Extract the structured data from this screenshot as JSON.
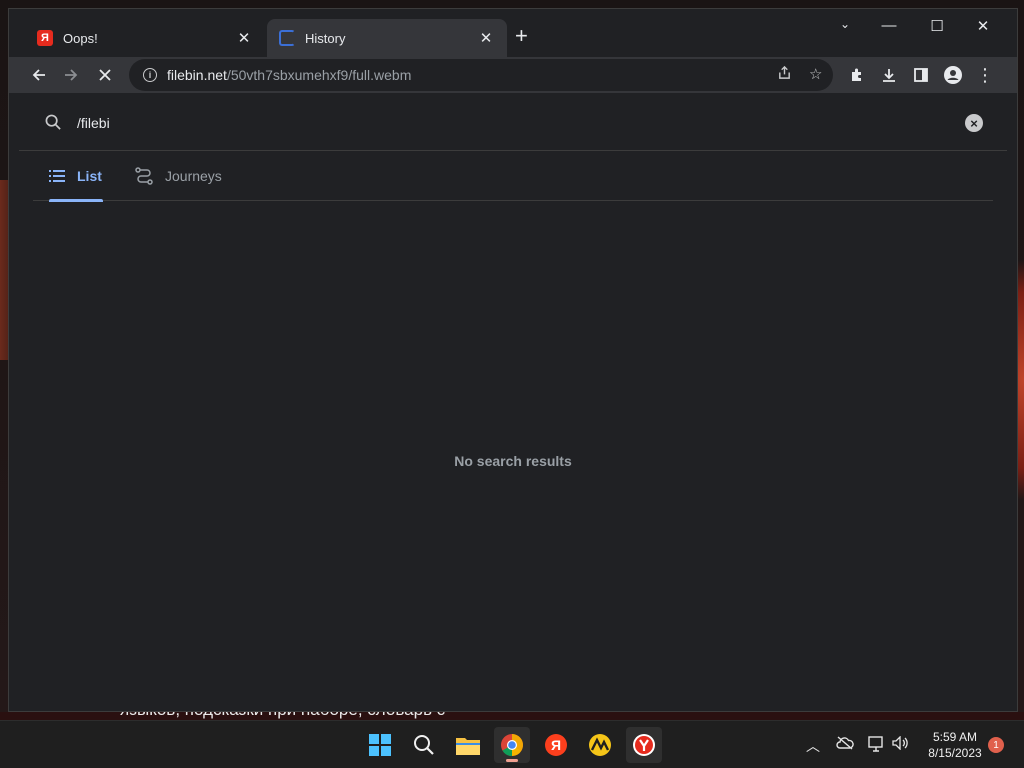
{
  "browser": {
    "tabs": [
      {
        "title": "Oops!",
        "favicon": "yandex-icon",
        "active": false
      },
      {
        "title": "History",
        "favicon": "loading-spinner-icon",
        "active": true
      }
    ],
    "url_host": "filebin.net",
    "url_path": "/50vth7sbxumehxf9/full.webm"
  },
  "history": {
    "search_value": "/filebi",
    "tabs": [
      {
        "label": "List",
        "icon": "list-icon",
        "selected": true
      },
      {
        "label": "Journeys",
        "icon": "journeys-icon",
        "selected": false
      }
    ],
    "empty_message": "No search results"
  },
  "desktop": {
    "background_text": "языков, подсказки при наборе, словарь с"
  },
  "taskbar": {
    "apps": [
      "windows-start-icon",
      "search-icon",
      "file-explorer-icon",
      "chrome-icon",
      "yandex-browser-icon",
      "app-icon",
      "yandex-icon"
    ],
    "time": "5:59 AM",
    "date": "8/15/2023",
    "notification_count": "1"
  },
  "colors": {
    "accent": "#8ab4f8",
    "tab_active_bg": "#35363a",
    "page_bg": "#202124"
  }
}
